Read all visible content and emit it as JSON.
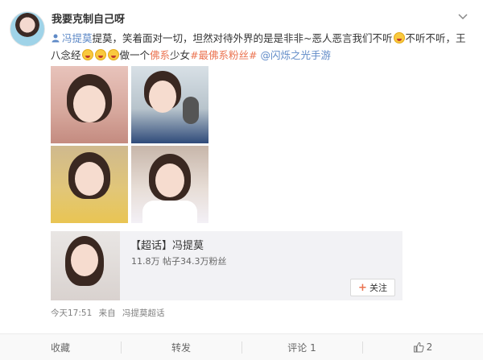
{
  "post": {
    "username": "我要克制自己呀",
    "text": {
      "mention_name": "冯提莫",
      "part1": "提莫，笑着面对一切，坦然对待外界的是是非非~恶人恶言我们不听",
      "part2": "不听不听，王八念经",
      "part3": "做一个",
      "keyword": "佛系",
      "part4": "少女",
      "hashtag": "#最佛系粉丝#",
      "game_link": "@闪烁之光手游"
    },
    "icons": {
      "caret": "chevron-down-icon",
      "mention": "person-icon",
      "emoji": "laughing-emoji-icon"
    },
    "accent_color": "#eb7350",
    "link_color": "#5f8ac7",
    "photos": [
      {
        "name": "photo-1"
      },
      {
        "name": "photo-2"
      },
      {
        "name": "photo-3"
      },
      {
        "name": "photo-4"
      }
    ],
    "card": {
      "title": "【超话】冯提莫",
      "stats": "11.8万  帖子34.3万粉丝",
      "follow_label": "关注"
    },
    "meta": {
      "time": "今天17:51",
      "source_prefix": "来自",
      "source": "冯提莫超话"
    }
  },
  "actions": {
    "favorite_label": "收藏",
    "repost_label": "转发",
    "comment_label": "评论 1",
    "like_count": "2"
  }
}
